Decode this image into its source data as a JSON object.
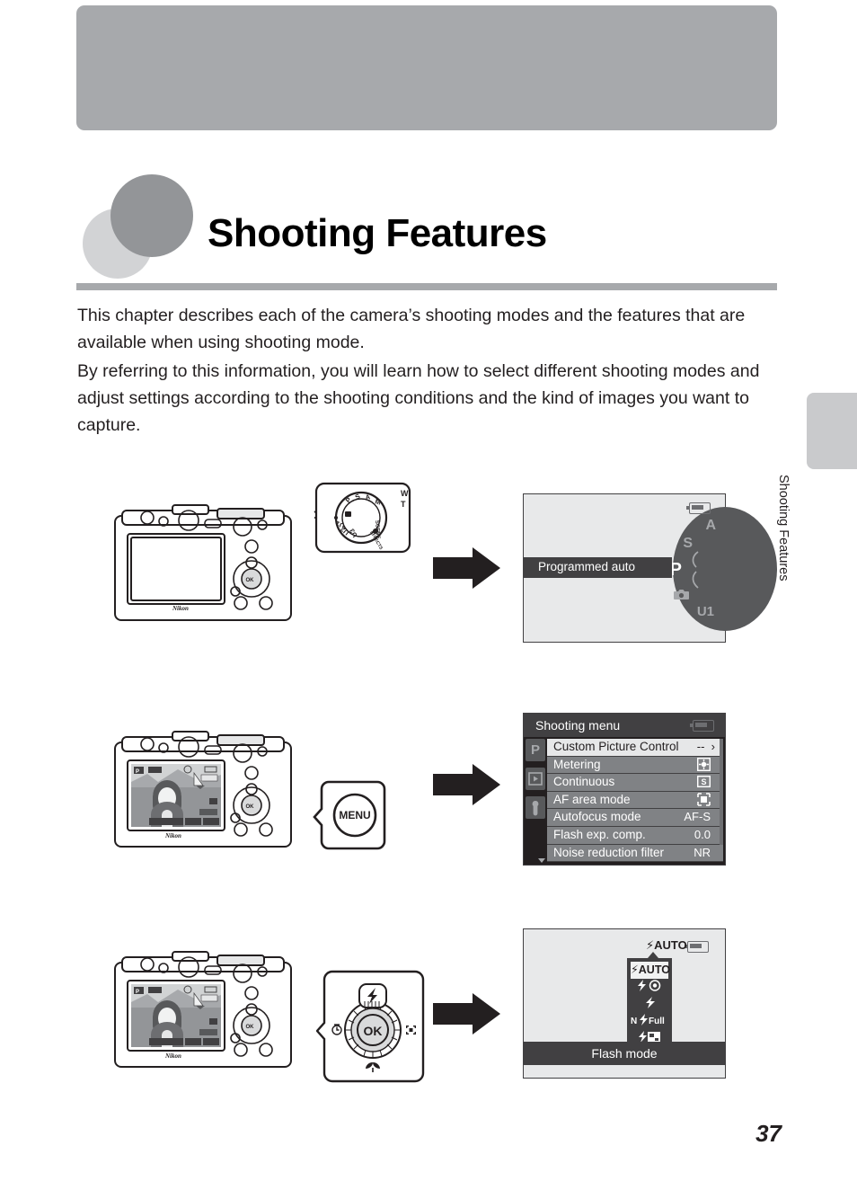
{
  "chapter": {
    "title": "Shooting Features",
    "side_tab_label": "Shooting Features",
    "page_number": "37",
    "intro_paragraph_1": "This chapter describes each of the camera’s shooting modes and the features that are available when using shooting mode.",
    "intro_paragraph_2": "By referring to this information, you will learn how to select different shooting modes and adjust settings according to the shooting conditions and the kind of images you want to capture."
  },
  "figure_dial": {
    "banner_label": "Programmed auto",
    "dial_positions": [
      "A",
      "S",
      "P",
      "camera-icon",
      "U1"
    ],
    "selected_position": "P",
    "battery_icon": "battery-icon",
    "mode_dial_marks": [
      "P",
      "S",
      "A",
      "M",
      "SCENE",
      "EFFECTS",
      "U3",
      "U2",
      "U1",
      "camera-auto"
    ],
    "dial_zoom_label_w": "W",
    "dial_zoom_label_t": "T"
  },
  "figure_menu": {
    "button_label": "MENU",
    "screen_title": "Shooting menu",
    "tabs": [
      {
        "name": "shooting-tab",
        "glyph": "P"
      },
      {
        "name": "playback-tab",
        "glyph": "▶"
      },
      {
        "name": "setup-tab",
        "glyph": "wrench"
      }
    ],
    "items": [
      {
        "label": "Custom Picture Control",
        "value": "--",
        "selected": true,
        "chevron": "›"
      },
      {
        "label": "Metering",
        "value": "matrix-metering-icon",
        "selected": false
      },
      {
        "label": "Continuous",
        "value": "single-shot-icon",
        "selected": false
      },
      {
        "label": "AF area mode",
        "value": "af-area-icon",
        "selected": false
      },
      {
        "label": "Autofocus mode",
        "value": "AF-S",
        "selected": false
      },
      {
        "label": "Flash exp. comp.",
        "value": "0.0",
        "selected": false
      },
      {
        "label": "Noise reduction filter",
        "value": "NR",
        "selected": false
      }
    ],
    "battery_icon": "battery-icon"
  },
  "figure_flash": {
    "caption": "Flash mode",
    "current_mode_label": "AUTO",
    "options": [
      {
        "label": "AUTO",
        "name": "flash-auto",
        "selected": true
      },
      {
        "label": "red-eye",
        "name": "flash-red-eye",
        "selected": false
      },
      {
        "label": "fill",
        "name": "flash-fill",
        "selected": false
      },
      {
        "label": "Full",
        "name": "flash-off-full",
        "selected": false
      },
      {
        "label": "slow-sync",
        "name": "flash-slow-sync",
        "selected": false
      }
    ],
    "battery_icon": "battery-icon"
  },
  "figure_multiselector": {
    "up_label": "flash-icon",
    "left_label": "self-timer-icon",
    "right_label": "focus-point-icon",
    "down_label": "macro-icon",
    "center_label": "OK"
  },
  "colors": {
    "header_gray": "#a7a9ac",
    "circle_light": "#d2d3d5",
    "circle_dark": "#939598",
    "screen_bg": "#e8e9ea",
    "dark": "#231f20",
    "menu_row": "#808285",
    "menu_dark": "#414042"
  }
}
